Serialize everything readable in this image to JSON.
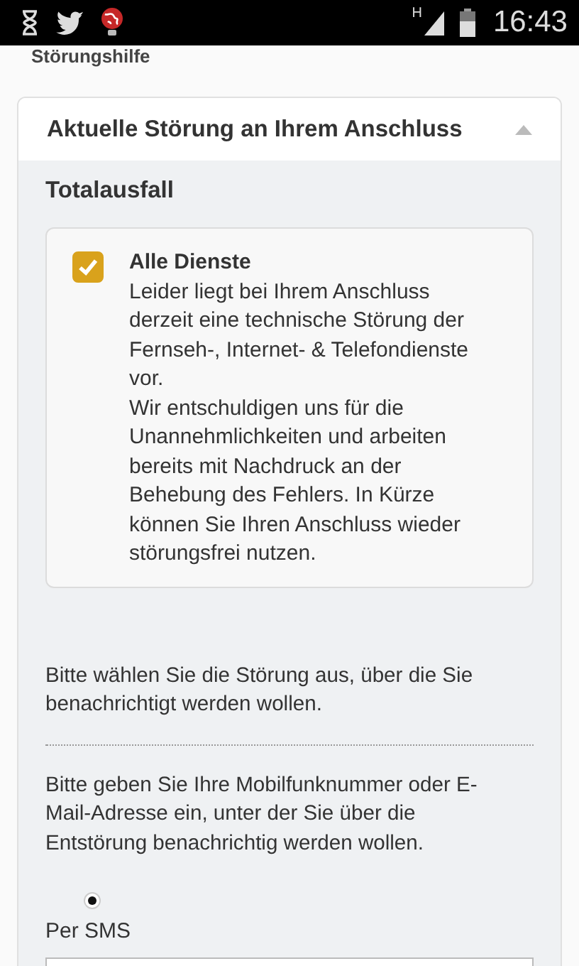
{
  "status_bar": {
    "network": "H",
    "time": "16:43"
  },
  "page_title": "Störungshilfe",
  "panel": {
    "title": "Aktuelle Störung an Ihrem Anschluss",
    "expanded": true,
    "section_title": "Totalausfall",
    "outage": {
      "checked": true,
      "title": "Alle Dienste",
      "paragraphs": [
        "Leider liegt bei Ihrem Anschluss derzeit eine technische Störung der Fernseh-, Internet- & Telefondienste vor.",
        "Wir entschuldigen uns für die Unannehmlichkeiten und arbeiten bereits mit Nachdruck an der Behebung des Fehlers. In Kürze können Sie Ihren Anschluss wieder störungsfrei nutzen."
      ]
    },
    "select_hint": "Bitte wählen Sie die Störung aus, über die Sie benachrichtigt werden wollen.",
    "contact_hint": "Bitte geben Sie Ihre Mobilfunknummer oder E-Mail-Adresse ein, unter der Sie über die Entstörung benachrichtig werden wollen.",
    "options": [
      {
        "label": "Per SMS",
        "selected": true
      }
    ]
  }
}
